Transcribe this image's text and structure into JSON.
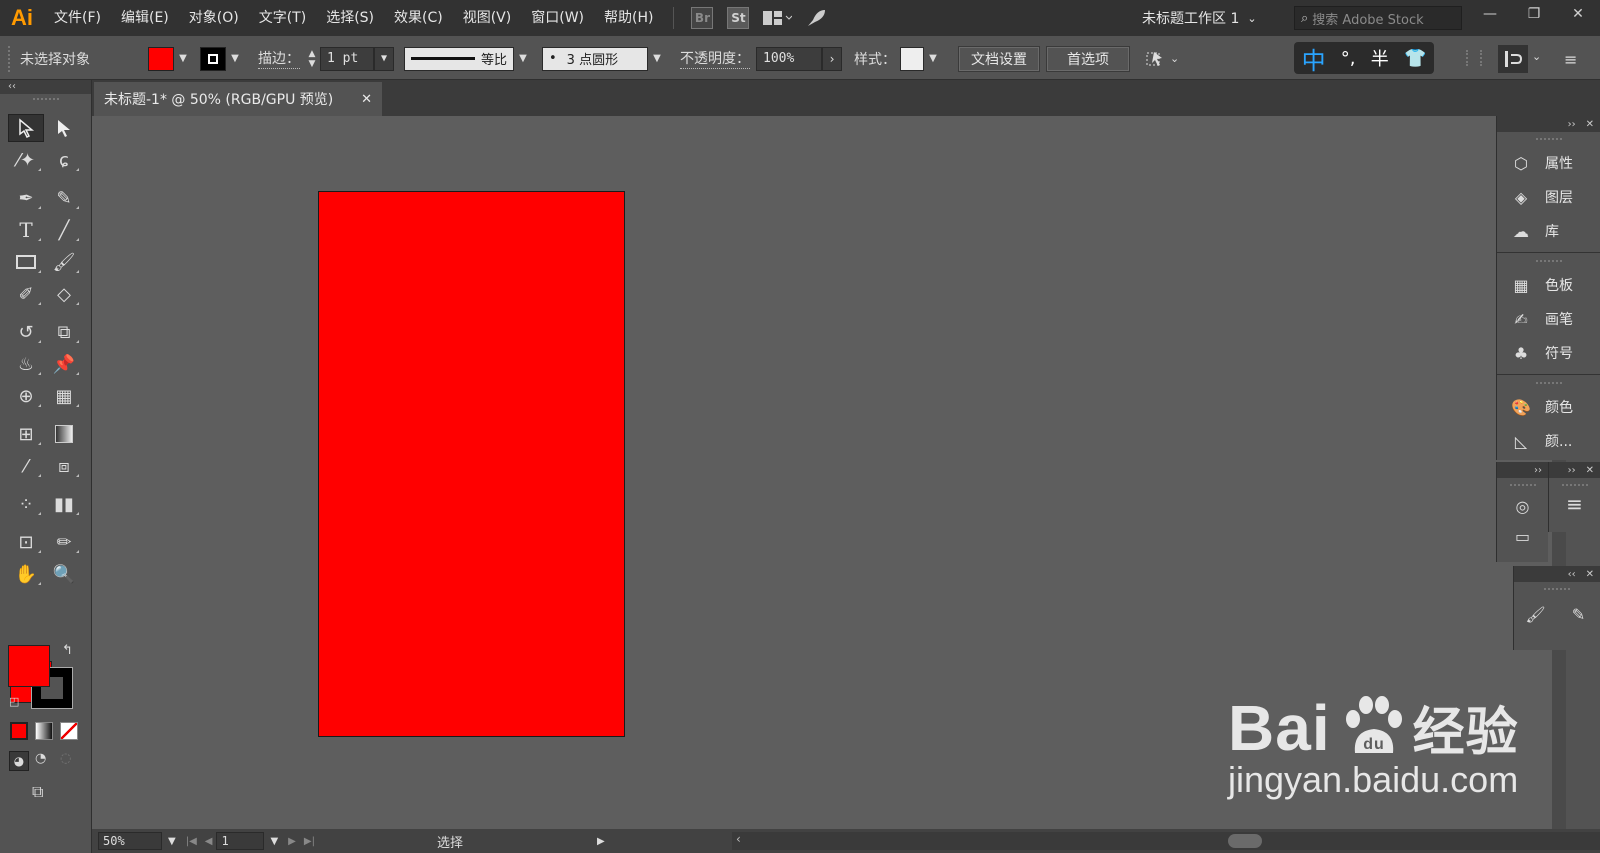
{
  "app": {
    "logo": "Ai",
    "accent_color": "#ff9a00"
  },
  "menu": {
    "items": [
      "文件(F)",
      "编辑(E)",
      "对象(O)",
      "文字(T)",
      "选择(S)",
      "效果(C)",
      "视图(V)",
      "窗口(W)",
      "帮助(H)"
    ],
    "bridge": "Br",
    "stock": "St",
    "workspace": "未标题工作区 1",
    "search_placeholder": "搜索 Adobe Stock"
  },
  "control_bar": {
    "selection_status": "未选择对象",
    "fill_color": "#ff0000",
    "stroke_label": "描边：",
    "stroke_weight": "1 pt",
    "stroke_profile": "等比",
    "brush_def": "3 点圆形",
    "opacity_label": "不透明度：",
    "opacity_value": "100%",
    "style_label": "样式：",
    "doc_setup_button": "文档设置",
    "prefs_button": "首选项"
  },
  "ime": {
    "mode": "中",
    "punct": "°,",
    "width": "半"
  },
  "document": {
    "tab_title": "未标题-1* @ 50% (RGB/GPU 预览)",
    "canvas_color": "#5e5e5e",
    "rect_fill": "#ff0000"
  },
  "toolbar": {
    "fill_color": "#ff0000",
    "stroke_color": "#000000"
  },
  "panels": {
    "group1": [
      "属性",
      "图层",
      "库"
    ],
    "group2": [
      "色板",
      "画笔",
      "符号"
    ],
    "group3": [
      "颜色",
      "颜..."
    ]
  },
  "status_bar": {
    "zoom": "50%",
    "artboard": "1",
    "tool_status": "选择"
  },
  "watermark": {
    "brand": "Bai",
    "brand_suffix": "经验",
    "url": "jingyan.baidu.com"
  }
}
